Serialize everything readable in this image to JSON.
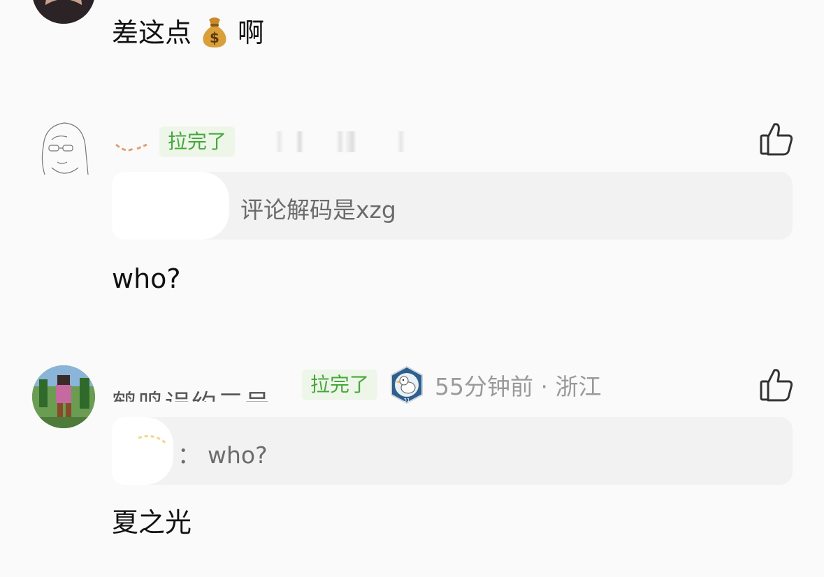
{
  "comments": [
    {
      "text_before_emoji": "差这点",
      "emoji": "money-bag",
      "text_after_emoji": "啊"
    },
    {
      "badge": "拉完了",
      "reply_quote": "评论解码是xzg",
      "text": "who?"
    },
    {
      "username": "鹤鸣误约三号",
      "badge": "拉完了",
      "time_location": "55分钟前 · 浙江",
      "reply_quote_prefix": "：",
      "reply_quote": "who?",
      "text": "夏之光"
    }
  ],
  "colors": {
    "badge_text": "#45a73a",
    "badge_bg": "#eef6ea",
    "meta_text": "#9a9a9a",
    "quote_bg": "#f2f2f2"
  }
}
